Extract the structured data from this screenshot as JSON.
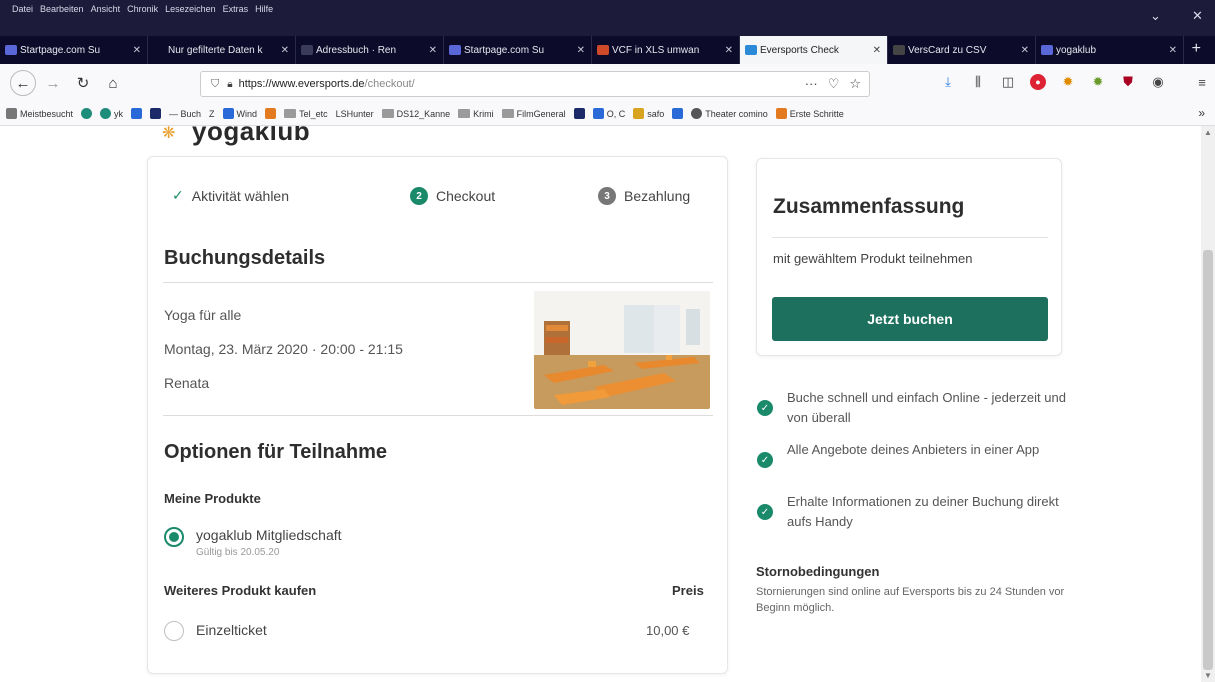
{
  "browser": {
    "menu": [
      "Datei",
      "Bearbeiten",
      "Ansicht",
      "Chronik",
      "Lesezeichen",
      "Extras",
      "Hilfe"
    ],
    "window_minimize": "⌄",
    "window_close": "✕",
    "tabs": [
      {
        "title": "Startpage.com Su",
        "active": false,
        "icon_color": "#5a67d8"
      },
      {
        "title": "Nur gefilterte Daten k",
        "active": false,
        "icon_color": "#0c0c2a"
      },
      {
        "title": "Adressbuch · Ren",
        "active": false,
        "icon_color": "#3a3a5a"
      },
      {
        "title": "Startpage.com Su",
        "active": false,
        "icon_color": "#5a67d8"
      },
      {
        "title": "VCF in XLS umwan",
        "active": false,
        "icon_color": "#d04a2a"
      },
      {
        "title": "Eversports Check",
        "active": true,
        "icon_color": "#2a8ad8"
      },
      {
        "title": "VersCard zu CSV",
        "active": false,
        "icon_color": "#444444"
      },
      {
        "title": "yogaklub",
        "active": false,
        "icon_color": "#5a67d8"
      }
    ],
    "tab_close": "✕",
    "new_tab": "+",
    "url": {
      "host": "https://www.eversports.de",
      "path": "/checkout/"
    },
    "url_actions": [
      "···",
      "♡",
      "☆"
    ],
    "bookmarks": [
      {
        "label": "Meistbesucht",
        "icon": "gear-icon",
        "color": "#777"
      },
      {
        "label": "",
        "icon": "circle-icon",
        "color": "#1e8c7a"
      },
      {
        "label": "yk",
        "icon": "circle-icon",
        "color": "#1e8c7a"
      },
      {
        "label": "",
        "icon": "square-icon",
        "color": "#2a6ad8"
      },
      {
        "label": "",
        "icon": "square-icon",
        "color": "#1c2a6a"
      },
      {
        "label": "— Buch",
        "icon": "",
        "color": ""
      },
      {
        "label": "Z",
        "icon": "",
        "color": ""
      },
      {
        "label": "Wind",
        "icon": "square-icon",
        "color": "#2a6ad8"
      },
      {
        "label": "",
        "icon": "square-icon",
        "color": "#e47a20"
      },
      {
        "label": "Tel_etc",
        "icon": "folder-icon",
        "color": "#9a9a9a"
      },
      {
        "label": "LSHunter",
        "icon": "",
        "color": ""
      },
      {
        "label": "DS12_Kanne",
        "icon": "folder-icon",
        "color": "#9a9a9a"
      },
      {
        "label": "Krimi",
        "icon": "folder-icon",
        "color": "#9a9a9a"
      },
      {
        "label": "FilmGeneral",
        "icon": "folder-icon",
        "color": "#9a9a9a"
      },
      {
        "label": "",
        "icon": "square-icon",
        "color": "#1c2a6a"
      },
      {
        "label": "O, C",
        "icon": "square-icon",
        "color": "#2a6ad8"
      },
      {
        "label": "safo",
        "icon": "square-icon",
        "color": "#d8a420"
      },
      {
        "label": "",
        "icon": "square-icon",
        "color": "#2a6ad8"
      },
      {
        "label": "Theater comino",
        "icon": "globe-icon",
        "color": "#555"
      },
      {
        "label": "Erste Schritte",
        "icon": "square-icon",
        "color": "#e47a20"
      }
    ],
    "bookmarks_more": "»"
  },
  "page": {
    "brand": "yogaklub",
    "steps": [
      {
        "label": "Aktivität wählen",
        "state": "done",
        "marker": "✓"
      },
      {
        "label": "Checkout",
        "state": "active",
        "marker": "2"
      },
      {
        "label": "Bezahlung",
        "state": "inactive",
        "marker": "3"
      }
    ],
    "booking": {
      "title": "Buchungsdetails",
      "class_name": "Yoga für alle",
      "datetime": "Montag, 23. März 2020 · 20:00 - 21:15",
      "teacher": "Renata"
    },
    "options": {
      "title": "Optionen für Teilnahme",
      "my_products_title": "Meine Produkte",
      "membership_label": "yogaklub Mitgliedschaft",
      "membership_note": "Gültig bis 20.05.20",
      "more_title": "Weiteres Produkt kaufen",
      "price_header": "Preis",
      "single_label": "Einzelticket",
      "single_price": "10,00 €"
    },
    "summary": {
      "title": "Zusammenfassung",
      "text": "mit gewähltem Produkt teilnehmen",
      "button": "Jetzt buchen"
    },
    "benefits": [
      "Buche schnell und einfach Online - jederzeit und von überall",
      "Alle Angebote deines Anbieters in einer App",
      "Erhalte Informationen zu deiner Buchung direkt aufs Handy"
    ],
    "cancellation": {
      "title": "Stornobedingungen",
      "text": "Stornierungen sind online auf Eversports bis zu 24 Stunden vor Beginn möglich."
    }
  },
  "colors": {
    "accent": "#1b8a6b",
    "button": "#1d6f5e",
    "titlebar": "#1c1b3a"
  }
}
